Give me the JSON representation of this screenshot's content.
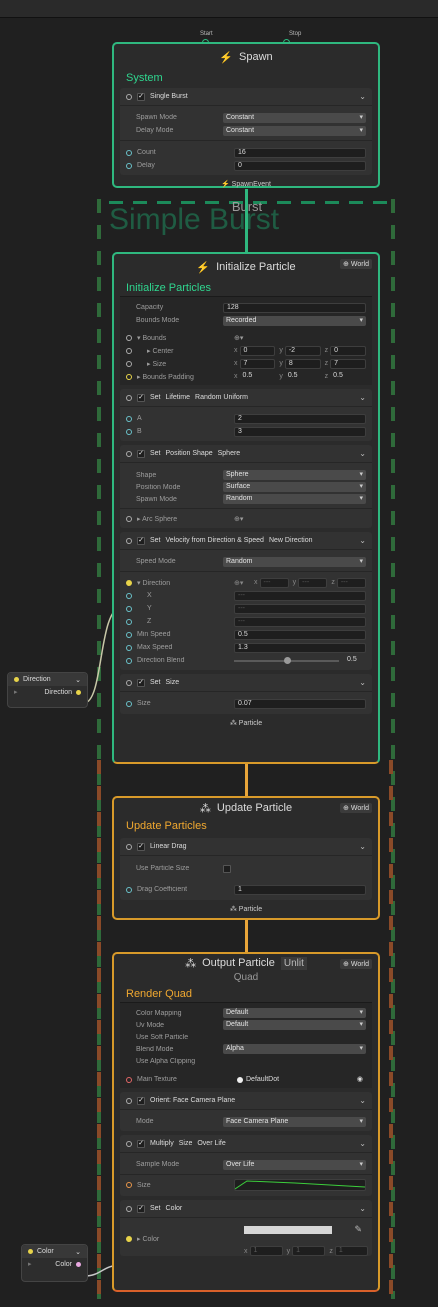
{
  "spawn": {
    "port_start": "Start",
    "port_stop": "Stop",
    "title": "Spawn",
    "section": "System",
    "block_title": "Single Burst",
    "spawn_mode_label": "Spawn Mode",
    "spawn_mode_value": "Constant",
    "delay_mode_label": "Delay Mode",
    "delay_mode_value": "Constant",
    "count_label": "Count",
    "count_value": "16",
    "delay_label": "Delay",
    "delay_value": "0",
    "event_out": "SpawnEvent"
  },
  "group": {
    "title": "Burst",
    "big_title": "Simple Burst"
  },
  "init": {
    "title": "Initialize Particle",
    "world": "World",
    "section": "Initialize Particles",
    "capacity_label": "Capacity",
    "capacity_value": "128",
    "bounds_mode_label": "Bounds Mode",
    "bounds_mode_value": "Recorded",
    "bounds_label": "Bounds",
    "center_label": "Center",
    "center": [
      "0",
      "-2",
      "0"
    ],
    "size_label": "Size",
    "size": [
      "7",
      "8",
      "7"
    ],
    "padding_label": "Bounds Padding",
    "padding": [
      "0.5",
      "0.5",
      "0.5"
    ],
    "lifetime_set": "Set",
    "lifetime_attr": "Lifetime",
    "lifetime_mode": "Random Uniform",
    "a_label": "A",
    "a_value": "2",
    "b_label": "B",
    "b_value": "3",
    "pos_set": "Set",
    "pos_attr": "Position Shape",
    "pos_mode": "Sphere",
    "shape_label": "Shape",
    "shape_value": "Sphere",
    "position_mode_label": "Position Mode",
    "position_mode_value": "Surface",
    "spawn_mode_label": "Spawn Mode",
    "spawn_mode_value": "Random",
    "arc_label": "Arc Sphere",
    "vel_set": "Set",
    "vel_attr": "Velocity from Direction & Speed",
    "vel_mode": "New Direction",
    "speed_mode_label": "Speed Mode",
    "speed_mode_value": "Random",
    "direction_label": "Direction",
    "direction_placeholder": "---",
    "x_label": "X",
    "y_label": "Y",
    "z_label": "Z",
    "min_speed_label": "Min Speed",
    "min_speed_value": "0.5",
    "max_speed_label": "Max Speed",
    "max_speed_value": "1.3",
    "blend_label": "Direction Blend",
    "blend_value": "0.5",
    "blend_fraction": 0.5,
    "size_set": "Set",
    "size_attr": "Size",
    "size_field_label": "Size",
    "size_field_value": "0.07",
    "flow_out": "Particle"
  },
  "direction_node": {
    "header": "Direction",
    "port": "Direction"
  },
  "update": {
    "title": "Update Particle",
    "world": "World",
    "section": "Update Particles",
    "block_title": "Linear Drag",
    "use_size_label": "Use Particle Size",
    "drag_label": "Drag Coefficient",
    "drag_value": "1",
    "flow_out": "Particle"
  },
  "output": {
    "title": "Output Particle",
    "title_badge": "Unlit",
    "subtitle": "Quad",
    "world": "World",
    "section": "Render Quad",
    "color_mapping_label": "Color Mapping",
    "color_mapping_value": "Default",
    "uv_mode_label": "Uv Mode",
    "uv_mode_value": "Default",
    "soft_label": "Use Soft Particle",
    "blend_mode_label": "Blend Mode",
    "blend_mode_value": "Alpha",
    "alpha_clip_label": "Use Alpha Clipping",
    "main_tex_label": "Main Texture",
    "main_tex_value": "DefaultDot",
    "orient_title": "Orient: Face Camera Plane",
    "orient_mode_label": "Mode",
    "orient_mode_value": "Face Camera Plane",
    "mult_prefix": "Multiply",
    "mult_attr": "Size",
    "mult_mode": "Over Life",
    "sample_mode_label": "Sample Mode",
    "sample_mode_value": "Over Life",
    "curve_label": "Size",
    "color_set": "Set",
    "color_attr": "Color",
    "color_label": "Color",
    "color_xyz": [
      "1",
      "1",
      "1"
    ]
  },
  "color_node": {
    "header": "Color",
    "port": "Color"
  },
  "colors": {
    "green": "#2fb87f",
    "orange": "#d89a2a",
    "red": "#d9602a"
  }
}
